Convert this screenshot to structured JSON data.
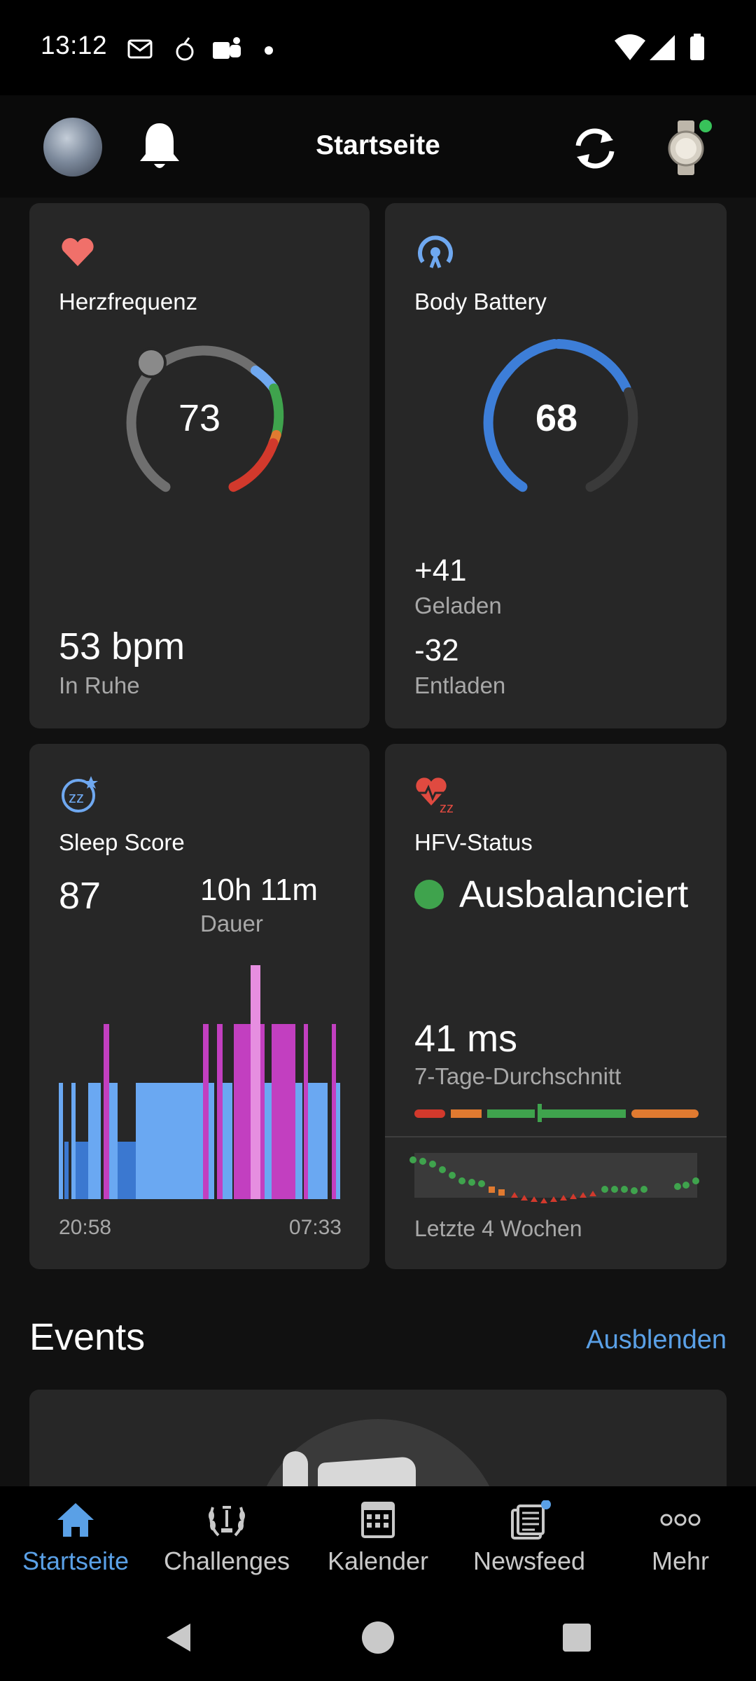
{
  "status_bar": {
    "time": "13:12",
    "notification_icons": [
      "mail-icon",
      "apple-icon",
      "teams-icon",
      "dot-icon"
    ],
    "system_icons": [
      "wifi-icon",
      "signal-icon",
      "battery-icon"
    ]
  },
  "app_bar": {
    "title": "Startseite",
    "icons": [
      "avatar",
      "bell-icon",
      "sync-icon",
      "watch-icon"
    ]
  },
  "heart_rate": {
    "title": "Herzfrequenz",
    "current": "73",
    "resting_value": "53 bpm",
    "resting_label": "In Ruhe",
    "accent": "#f0706a"
  },
  "body_battery": {
    "title": "Body Battery",
    "value": "68",
    "level": 68,
    "charged_value": "+41",
    "charged_label": "Geladen",
    "drained_value": "-32",
    "drained_label": "Entladen",
    "accent": "#3d7ed8"
  },
  "sleep": {
    "title": "Sleep Score",
    "score": "87",
    "duration": "10h 11m",
    "duration_label": "Dauer",
    "start_time": "20:58",
    "end_time": "07:33",
    "colors": {
      "light": "#6aa8f2",
      "deep": "#3b78d0",
      "rem": "#c23fc0",
      "awake": "#e68ee0"
    }
  },
  "hrv": {
    "title": "HFV-Status",
    "status": "Ausbalanciert",
    "status_color": "#3fa34d",
    "value": "41 ms",
    "value_label": "7-Tage-Durchschnitt",
    "range_label": "Letzte 4 Wochen"
  },
  "events": {
    "title": "Events",
    "action": "Ausblenden"
  },
  "bottom_nav": {
    "items": [
      {
        "label": "Startseite",
        "icon": "home-icon",
        "active": true
      },
      {
        "label": "Challenges",
        "icon": "laurel-icon",
        "active": false
      },
      {
        "label": "Kalender",
        "icon": "calendar-icon",
        "active": false
      },
      {
        "label": "Newsfeed",
        "icon": "newsfeed-icon",
        "active": false
      },
      {
        "label": "Mehr",
        "icon": "more-icon",
        "active": false
      }
    ],
    "active_color": "#5aa0e6"
  }
}
